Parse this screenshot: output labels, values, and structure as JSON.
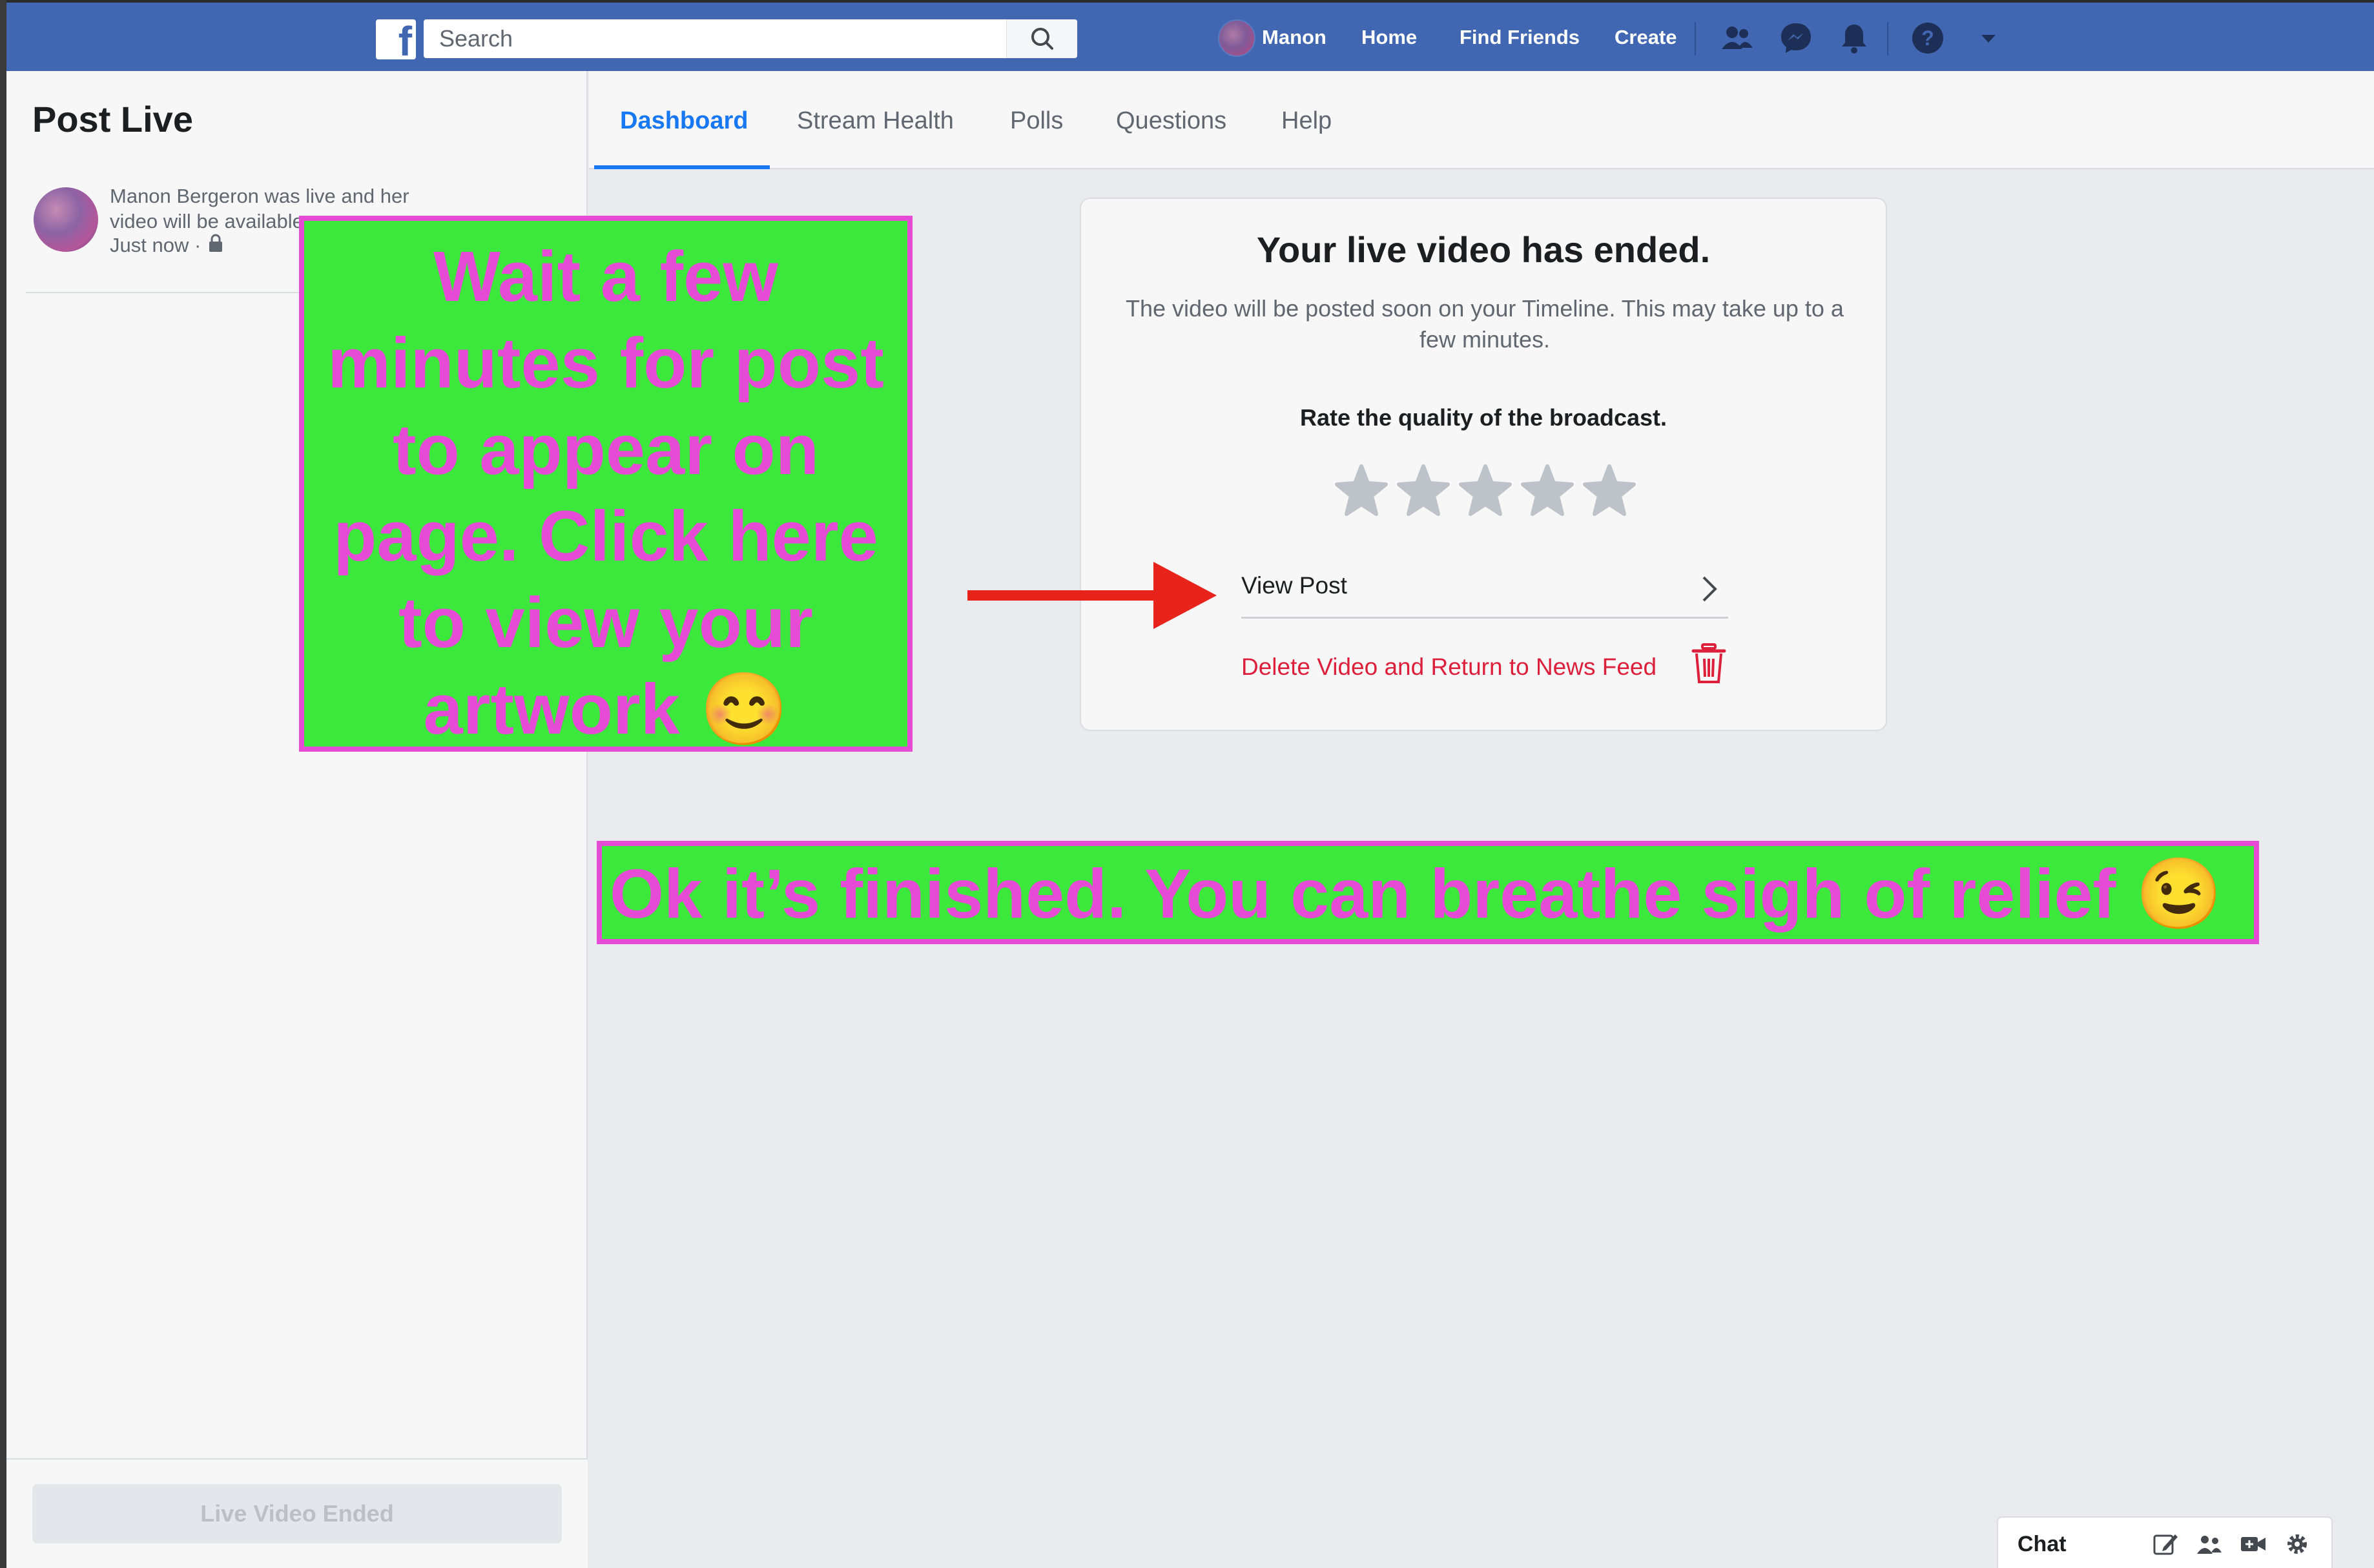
{
  "topbar": {
    "search_placeholder": "Search",
    "user_name": "Manon",
    "links": [
      "Home",
      "Find Friends",
      "Create"
    ],
    "icons": [
      "friends-icon",
      "messenger-icon",
      "notifications-icon",
      "help-icon",
      "caret-down-icon"
    ],
    "brand_color": "#4267b2"
  },
  "left_panel": {
    "title": "Post Live",
    "post_text": "Manon Bergeron was live and her video will be available",
    "post_time": "Just now ·",
    "privacy_icon": "lock-icon",
    "footer_button": "Live Video Ended"
  },
  "tabs": [
    "Dashboard",
    "Stream Health",
    "Polls",
    "Questions",
    "Help"
  ],
  "active_tab": "Dashboard",
  "card": {
    "title": "Your live video has ended.",
    "subtitle": "The video will be posted soon on your Timeline. This may take up to a few minutes.",
    "rate_label": "Rate the quality of the broadcast.",
    "star_count": 5,
    "rating": 0,
    "view_post": "View Post",
    "delete_link": "Delete Video and Return to News Feed",
    "delete_color": "#dc1f3a"
  },
  "overlays": {
    "note": "Wait a few minutes for post to appear on page. Click here to view your artwork 😊",
    "banner": "Ok it’s finished. You can breathe sigh of relief 😉",
    "note_bg": "#3be83b",
    "note_fg": "#e64bd6",
    "arrow_color": "#e8231b"
  },
  "chat": {
    "label": "Chat",
    "icons": [
      "new-message-icon",
      "create-group-icon",
      "video-call-icon",
      "settings-icon"
    ]
  }
}
